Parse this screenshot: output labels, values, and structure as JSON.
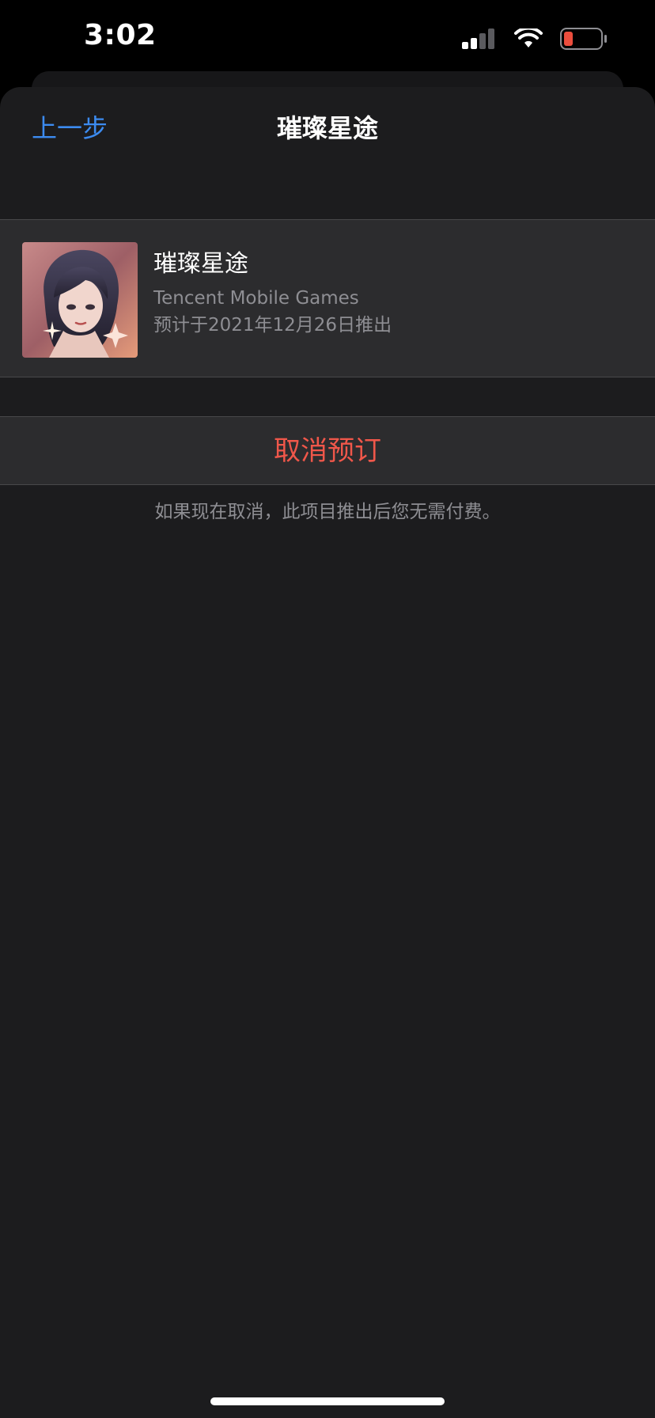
{
  "status_bar": {
    "time": "3:02",
    "icons": [
      "cellular-signal-icon",
      "wifi-icon",
      "battery-low-icon"
    ],
    "battery_color": "#eb4d3d"
  },
  "nav": {
    "back_label": "上一步",
    "title": "璀璨星途"
  },
  "app": {
    "name": "璀璨星途",
    "developer": "Tencent Mobile Games",
    "release_info": "预计于2021年12月26日推出",
    "icon": "app-icon"
  },
  "actions": {
    "cancel_label": "取消预订",
    "cancel_color": "#f0574a"
  },
  "footnote": "如果现在取消，此项目推出后您无需付费。",
  "colors": {
    "accent": "#3c8bf0",
    "background": "#1c1c1e",
    "cell": "#2c2c2e"
  }
}
